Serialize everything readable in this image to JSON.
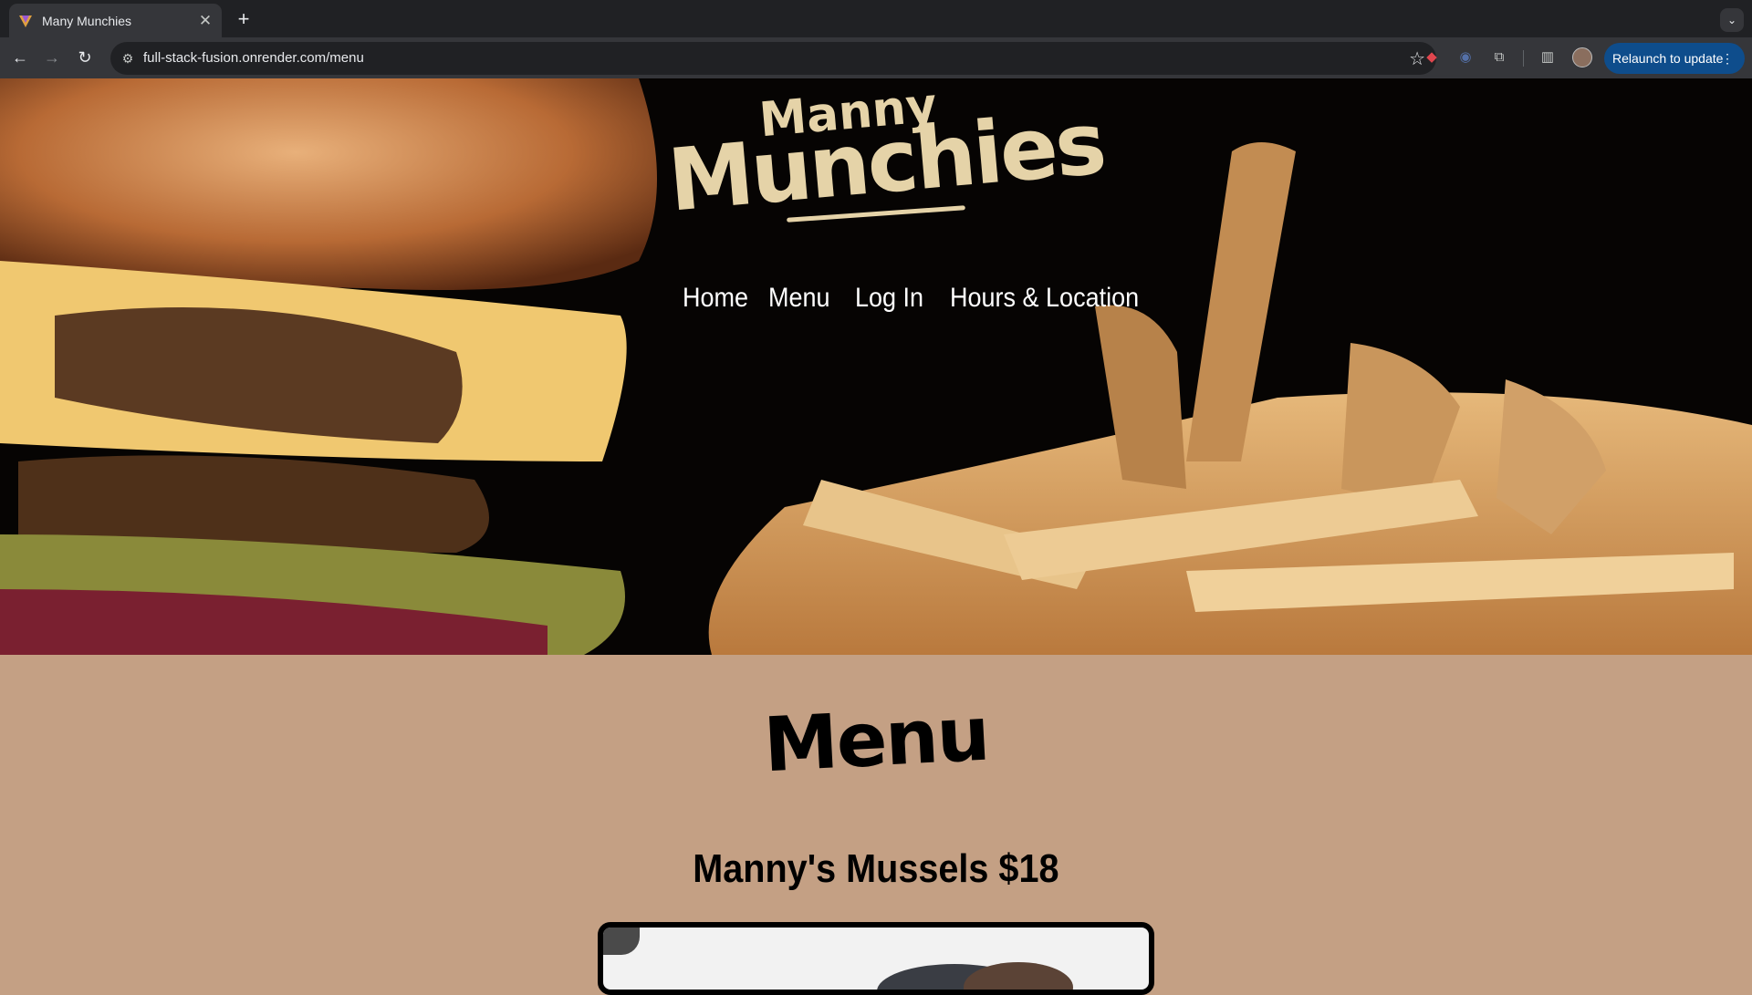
{
  "browser": {
    "tab_title": "Many Munchies",
    "url": "full-stack-fusion.onrender.com/menu",
    "relaunch_label": "Relaunch to update"
  },
  "site": {
    "logo_top": "Manny",
    "logo_bottom": "Munchies",
    "nav": [
      {
        "label": "Home"
      },
      {
        "label": "Menu"
      },
      {
        "label": "Log In"
      },
      {
        "label": "Hours & Location"
      }
    ]
  },
  "page": {
    "heading": "Menu",
    "items": [
      {
        "title": "Manny's Mussels $18"
      }
    ]
  },
  "colors": {
    "page_bg": "#c4a084",
    "logo": "#e5d3a8",
    "relaunch_button": "#0e4d8c"
  }
}
